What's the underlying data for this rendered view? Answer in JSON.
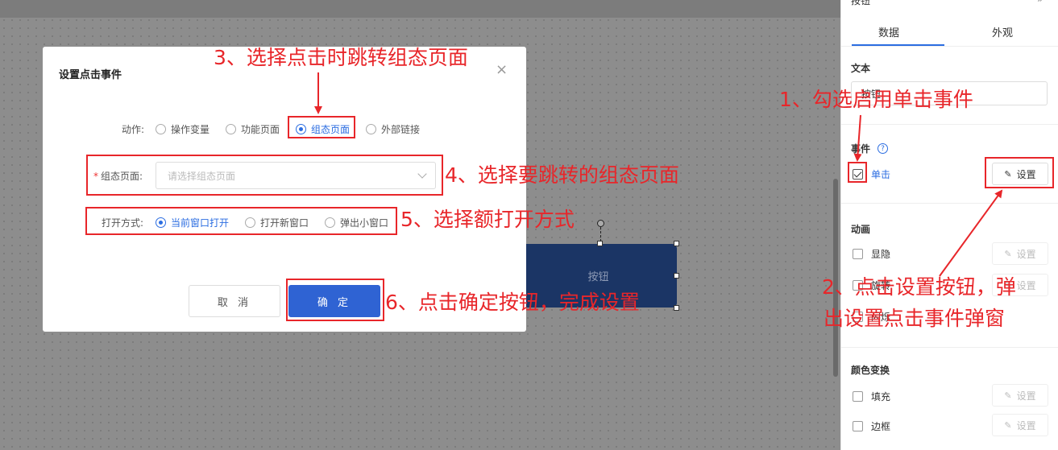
{
  "panel": {
    "header": "按钮",
    "header_arrow": "»",
    "tabs": [
      "数据",
      "外观"
    ],
    "text_section_title": "文本",
    "text_value": "按钮",
    "event_section_title": "事件",
    "help": "?",
    "click_label": "单击",
    "set_label": "设置",
    "animation_title": "动画",
    "animation_items": [
      "显隐",
      "旋转",
      "闪烁"
    ],
    "color_title": "颜色变换",
    "color_items": [
      "填充",
      "边框"
    ]
  },
  "canvas": {
    "button_label": "按钮"
  },
  "dialog": {
    "title": "设置点击事件",
    "close": "×",
    "action_label": "动作:",
    "actions": [
      "操作变量",
      "功能页面",
      "组态页面",
      "外部链接"
    ],
    "selected_action": "组态页面",
    "required_mark": "*",
    "page_label": "组态页面:",
    "page_placeholder": "请选择组态页面",
    "open_label": "打开方式:",
    "open_options": [
      "当前窗口打开",
      "打开新窗口",
      "弹出小窗口"
    ],
    "selected_open": "当前窗口打开",
    "cancel": "取 消",
    "confirm": "确 定"
  },
  "annotations": {
    "step1": "1、勾选启用单击事件",
    "step2_line1": "2、点击设置按钮，弹",
    "step2_line2": "出设置点击事件弹窗",
    "step3": "3、选择点击时跳转组态页面",
    "step4": "4、选择要跳转的组态页面",
    "step5": "5、选择额打开方式",
    "step6": "6、点击确定按钮，完成设置",
    "color": "#e8262a"
  }
}
